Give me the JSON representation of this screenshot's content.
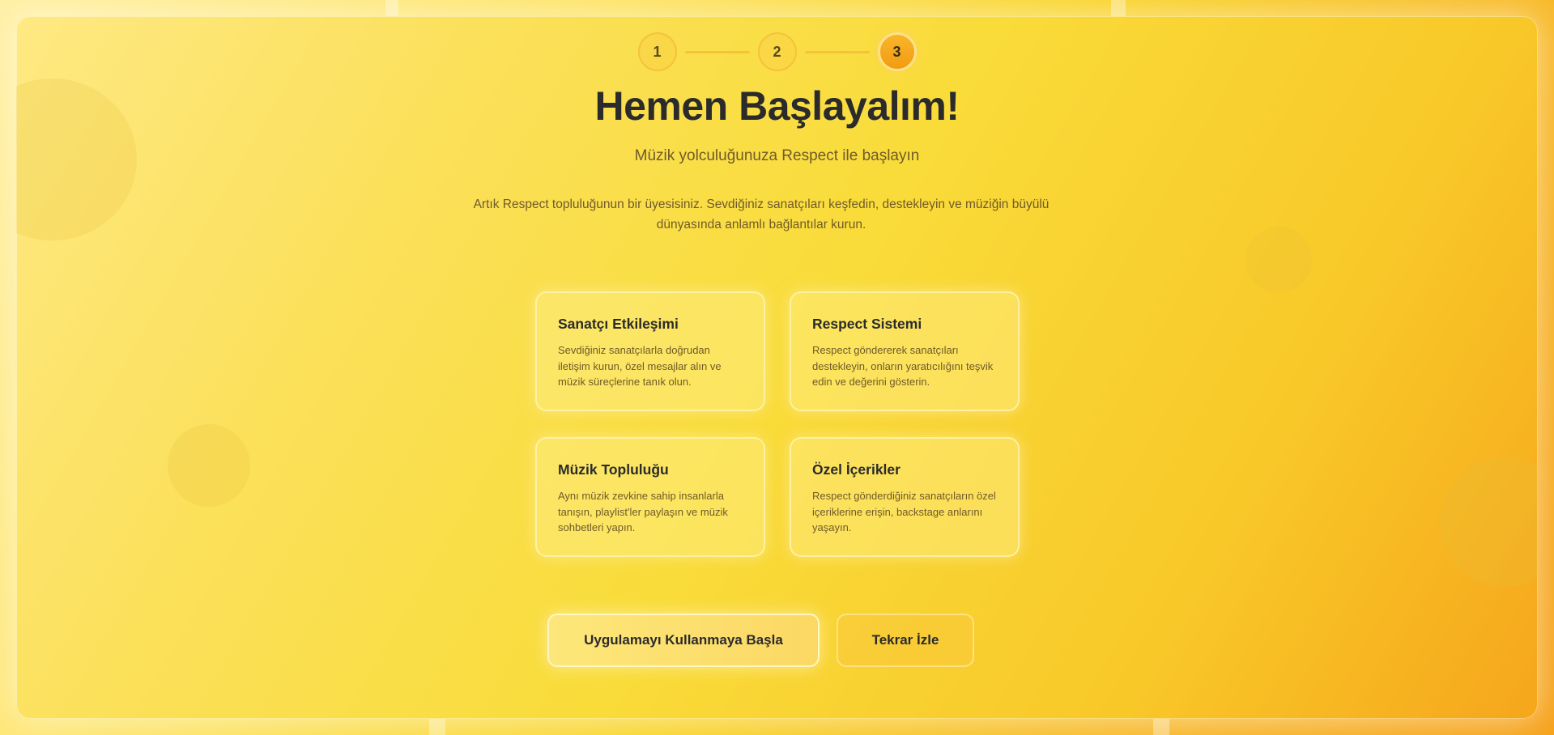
{
  "stepper": {
    "steps": [
      {
        "label": "1",
        "state": "done"
      },
      {
        "label": "2",
        "state": "done"
      },
      {
        "label": "3",
        "state": "active"
      }
    ]
  },
  "header": {
    "title": "Hemen Başlayalım!",
    "subtitle": "Müzik yolculuğunuza Respect ile başlayın",
    "description": "Artık Respect topluluğunun bir üyesisiniz. Sevdiğiniz sanatçıları keşfedin, destekleyin ve müziğin büyülü dünyasında anlamlı bağlantılar kurun."
  },
  "features": [
    {
      "title": "Sanatçı Etkileşimi",
      "text": "Sevdiğiniz sanatçılarla doğrudan iletişim kurun, özel mesajlar alın ve müzik süreçlerine tanık olun."
    },
    {
      "title": "Respect Sistemi",
      "text": "Respect göndererek sanatçıları destekleyin, onların yaratıcılığını teşvik edin ve değerini gösterin."
    },
    {
      "title": "Müzik Topluluğu",
      "text": "Aynı müzik zevkine sahip insanlarla tanışın, playlist'ler paylaşın ve müzik sohbetleri yapın."
    },
    {
      "title": "Özel İçerikler",
      "text": "Respect gönderdiğiniz sanatçıların özel içeriklerine erişin, backstage anlarını yaşayın."
    }
  ],
  "actions": {
    "start_label": "Uygulamayı Kullanmaya Başla",
    "replay_label": "Tekrar İzle"
  },
  "colors": {
    "accent": "#f39b10",
    "text_dark": "#2b2b2b",
    "text_muted": "#6f5a2a"
  }
}
